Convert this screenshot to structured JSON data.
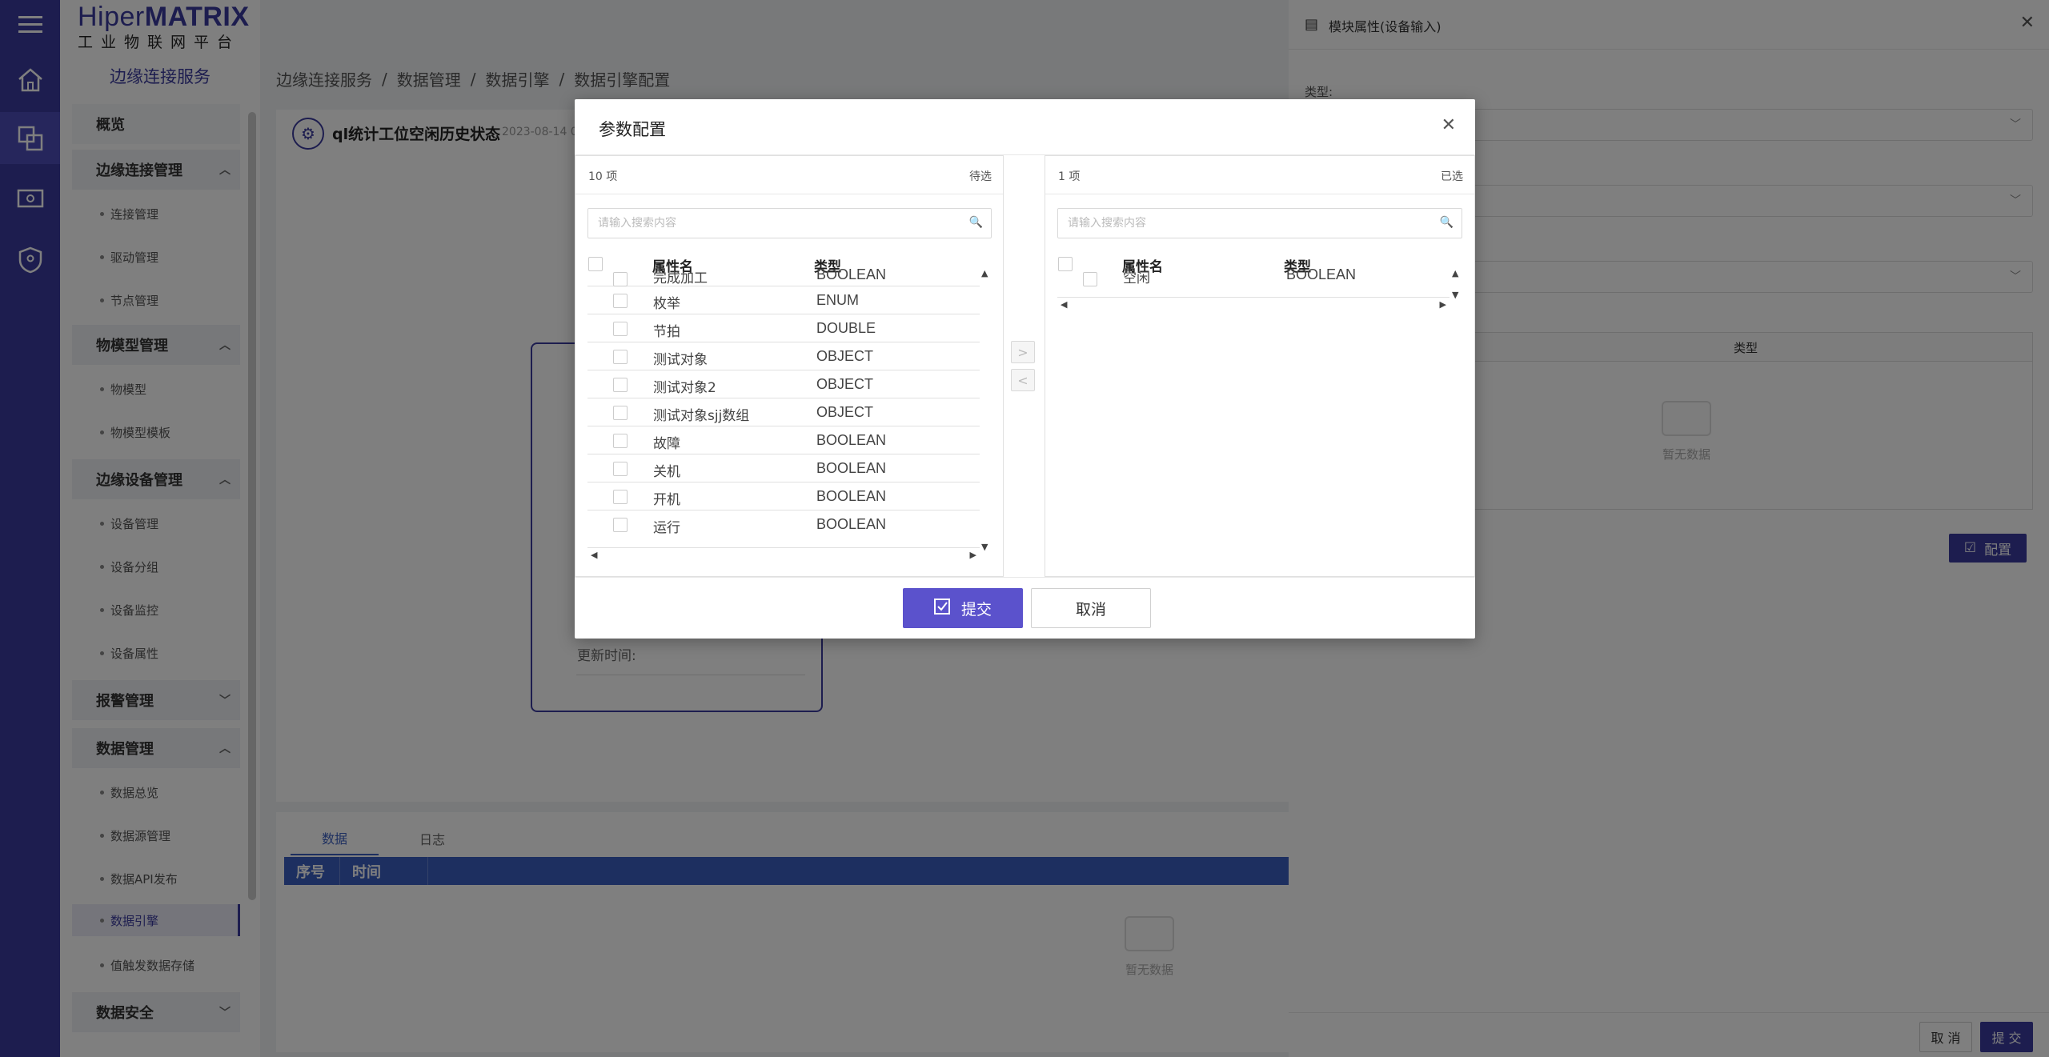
{
  "app": {
    "logo_main": "Hiper",
    "logo_bold": "MATRIX",
    "logo_sub": "工业物联网平台",
    "brand_color": "#3b3b9e"
  },
  "iconbar": {
    "icons": [
      "menu-icon",
      "home-icon",
      "edge-service-icon",
      "monitor-icon",
      "shield-icon"
    ]
  },
  "sidebar": {
    "title": "边缘连接服务",
    "overview": "概览",
    "groups": [
      {
        "label": "边缘连接管理",
        "items": [
          "连接管理",
          "驱动管理",
          "节点管理"
        ]
      },
      {
        "label": "物模型管理",
        "items": [
          "物模型",
          "物模型模板"
        ]
      },
      {
        "label": "边缘设备管理",
        "items": [
          "设备管理",
          "设备分组",
          "设备监控",
          "设备属性"
        ]
      },
      {
        "label": "报警管理",
        "items": []
      },
      {
        "label": "数据管理",
        "items": [
          "数据总览",
          "数据源管理",
          "数据API发布",
          "数据引擎",
          "值触发数据存储"
        ]
      },
      {
        "label": "数据安全",
        "items": []
      }
    ],
    "active_item": "数据引擎"
  },
  "breadcrumb": {
    "items": [
      "边缘连接服务",
      "数据管理",
      "数据引擎",
      "数据引擎配置"
    ],
    "separator": "/"
  },
  "page": {
    "title": "ql统计工位空闲历史状态",
    "date": "2023-08-14 0"
  },
  "card": {
    "update_label": "更新时间:"
  },
  "bottom": {
    "tabs": [
      "数据",
      "日志"
    ],
    "columns": [
      "序号",
      "时间"
    ],
    "empty": "暂无数据"
  },
  "drawer": {
    "title": "模块属性(设备输入)",
    "type_label": "类型:",
    "table_col_type": "类型",
    "empty": "暂无数据",
    "config_button": "配置",
    "cancel_button": "取 消",
    "submit_button": "提 交"
  },
  "modal": {
    "title": "参数配置",
    "left": {
      "count": "10 项",
      "status": "待选",
      "search_placeholder": "请输入搜索内容",
      "col_name": "属性名",
      "col_type": "类型",
      "rows": [
        {
          "name": "完成加工",
          "type": "BOOLEAN"
        },
        {
          "name": "枚举",
          "type": "ENUM"
        },
        {
          "name": "节拍",
          "type": "DOUBLE"
        },
        {
          "name": "测试对象",
          "type": "OBJECT"
        },
        {
          "name": "测试对象2",
          "type": "OBJECT"
        },
        {
          "name": "测试对象sjj数组",
          "type": "OBJECT"
        },
        {
          "name": "故障",
          "type": "BOOLEAN"
        },
        {
          "name": "关机",
          "type": "BOOLEAN"
        },
        {
          "name": "开机",
          "type": "BOOLEAN"
        },
        {
          "name": "运行",
          "type": "BOOLEAN"
        }
      ]
    },
    "right": {
      "count": "1 项",
      "status": "已选",
      "search_placeholder": "请输入搜索内容",
      "col_name": "属性名",
      "col_type": "类型",
      "rows": [
        {
          "name": "空闲",
          "type": "BOOLEAN"
        }
      ]
    },
    "move_right": ">",
    "move_left": "<",
    "submit": "提交",
    "cancel": "取消"
  }
}
